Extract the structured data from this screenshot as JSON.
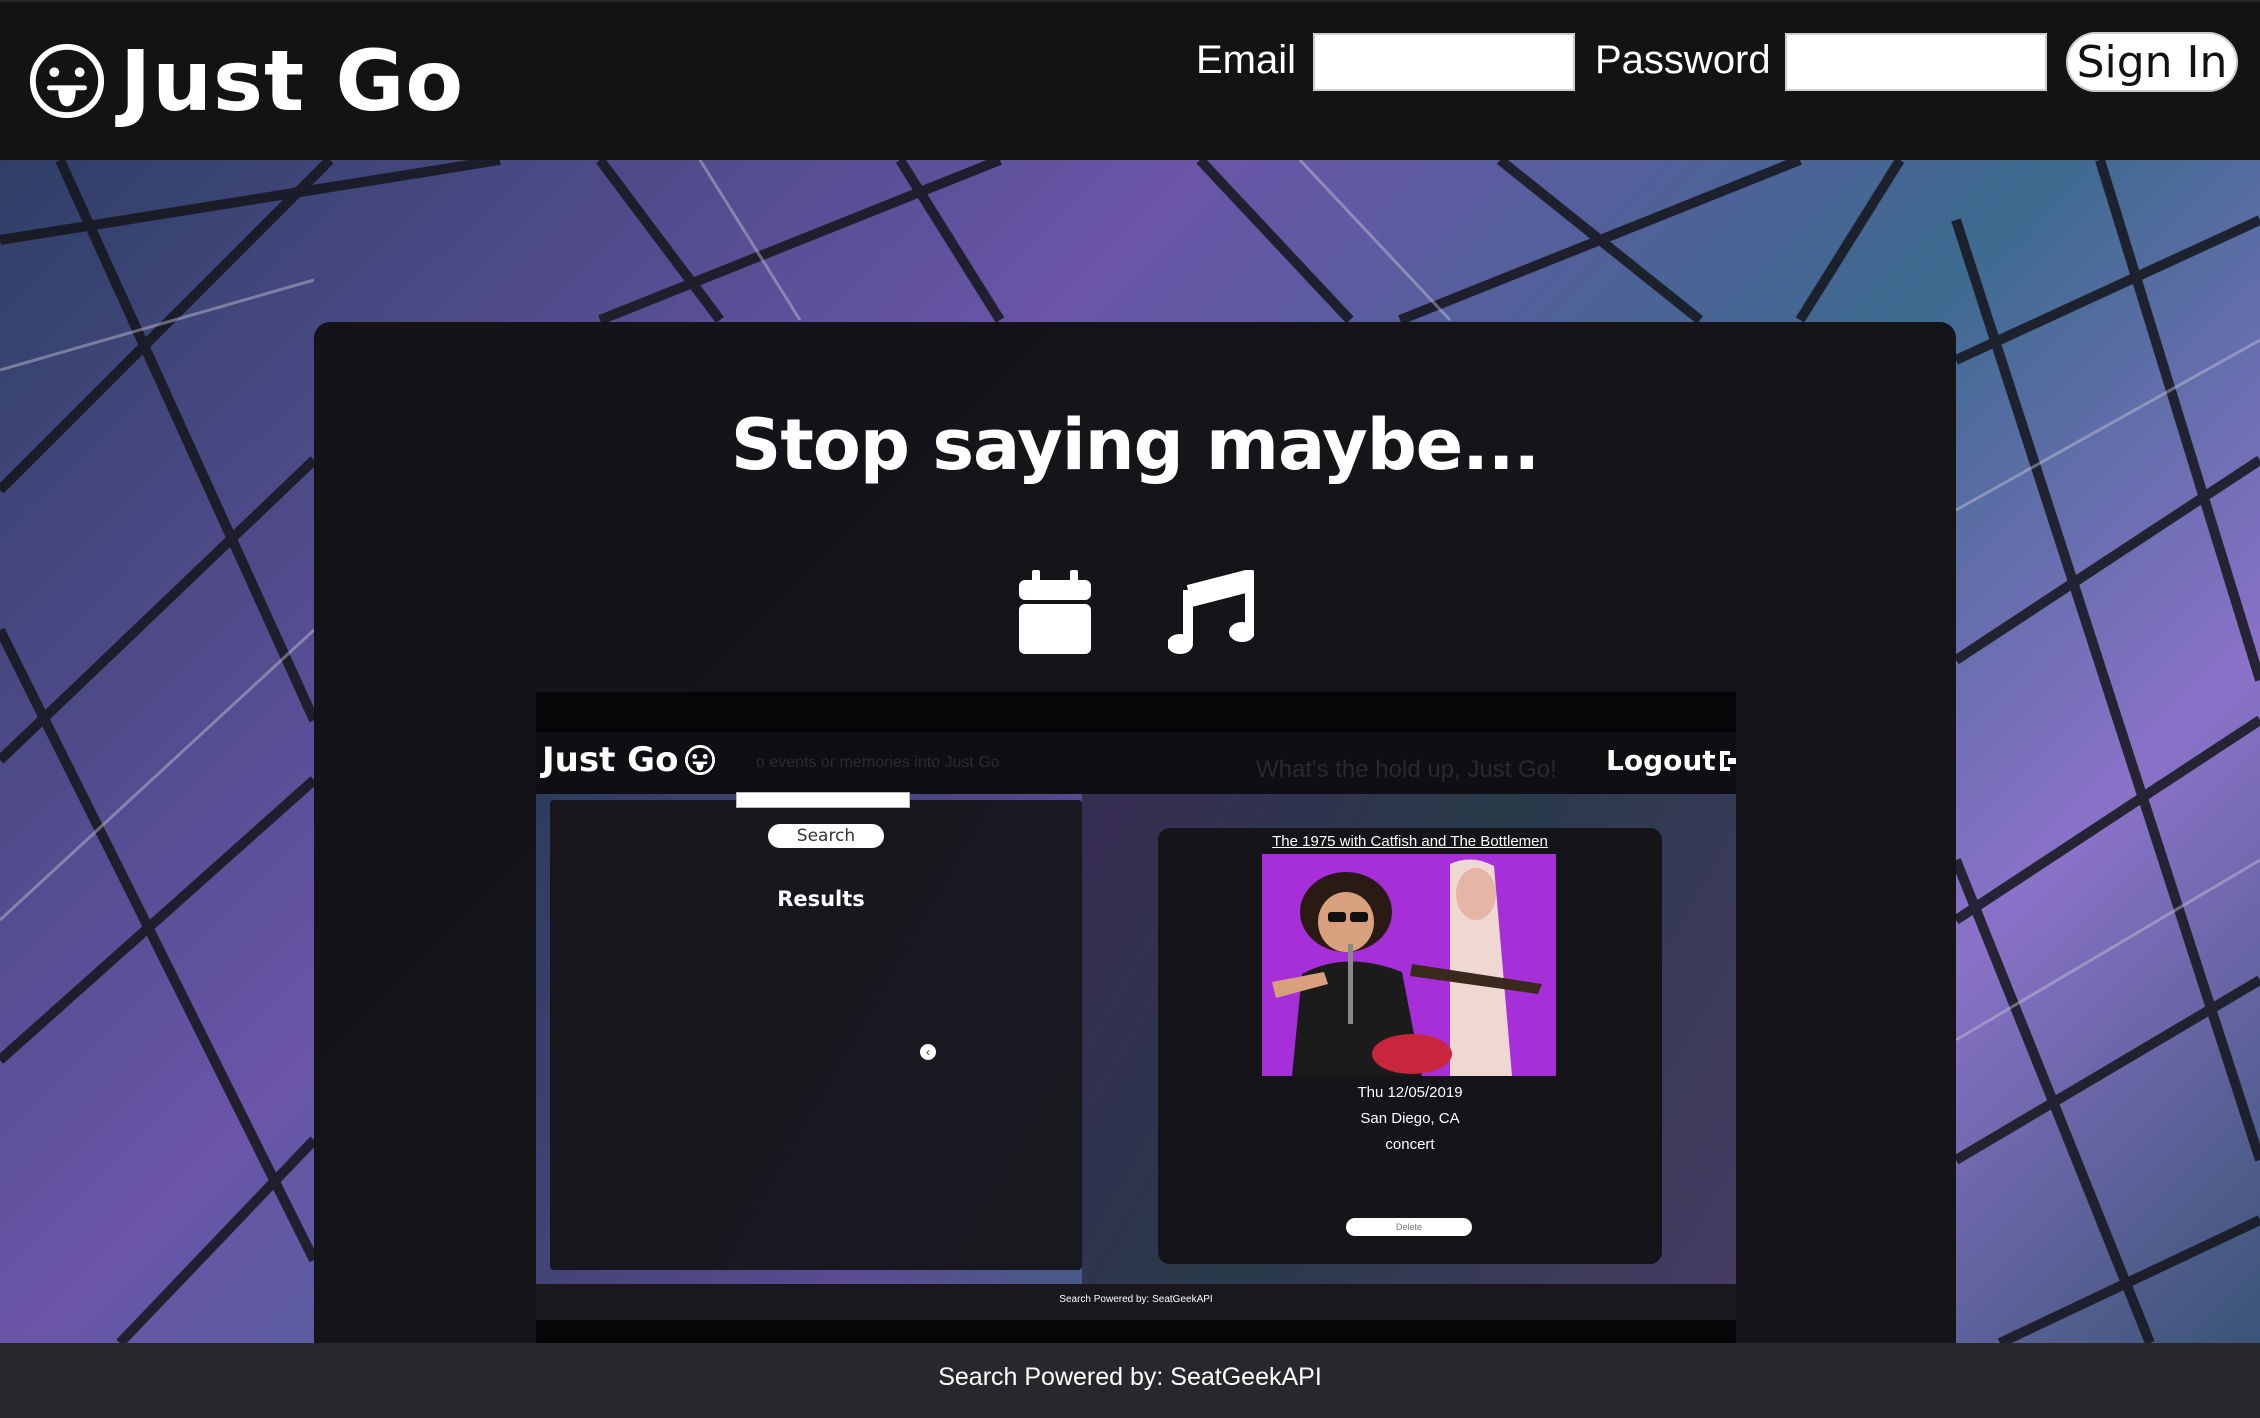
{
  "header": {
    "brand": "Just Go",
    "email_label": "Email",
    "email_value": "",
    "password_label": "Password",
    "password_value": "",
    "signin_label": "Sign In"
  },
  "hero": {
    "tagline": "Stop saying maybe...",
    "icons": [
      "calendar-icon",
      "music-note-icon"
    ]
  },
  "preview": {
    "brand": "Just Go",
    "faint_text_left": "o events or memories into Just Go",
    "faint_text_right": "What's the hold up, Just Go!",
    "logout_label": "Logout",
    "search_button": "Search",
    "results_heading": "Results",
    "event": {
      "title": "The 1975 with Catfish and The Bottlemen",
      "date": "Thu 12/05/2019",
      "location": "San Diego, CA",
      "type": "concert",
      "delete_label": "Delete"
    },
    "footer_text": "Search Powered by: SeatGeekAPI"
  },
  "footer": {
    "text": "Search Powered by: SeatGeekAPI"
  },
  "colors": {
    "header_bg": "#131215",
    "card_bg": "#131215",
    "photo_bg": "#a430d8",
    "footer_bg": "#28272b"
  }
}
